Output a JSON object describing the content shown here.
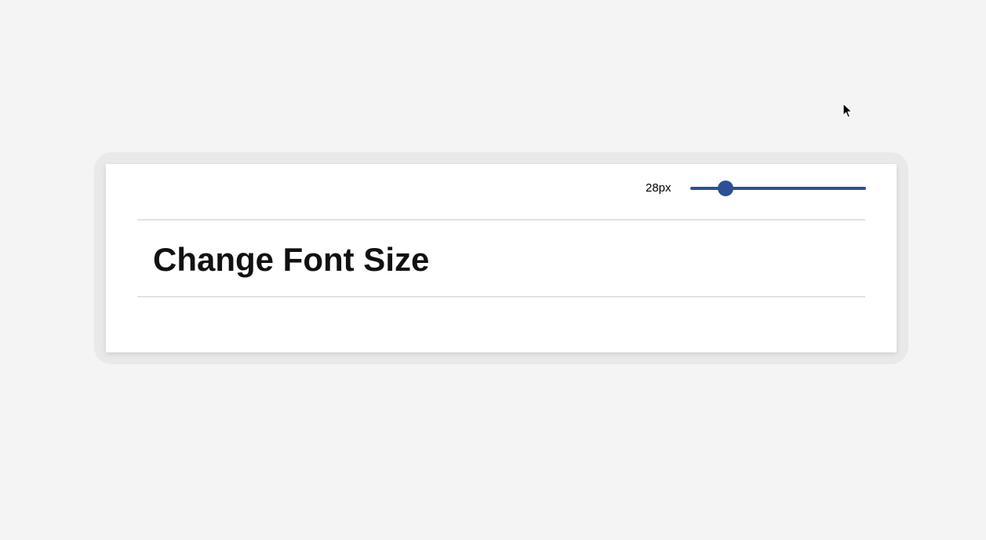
{
  "controls": {
    "font_size_label": "28px",
    "slider": {
      "value_fraction": 0.17,
      "color": "#2c4f95"
    }
  },
  "content": {
    "heading": "Change Font Size"
  },
  "icons": {
    "cursor": "mouse-pointer-icon"
  }
}
